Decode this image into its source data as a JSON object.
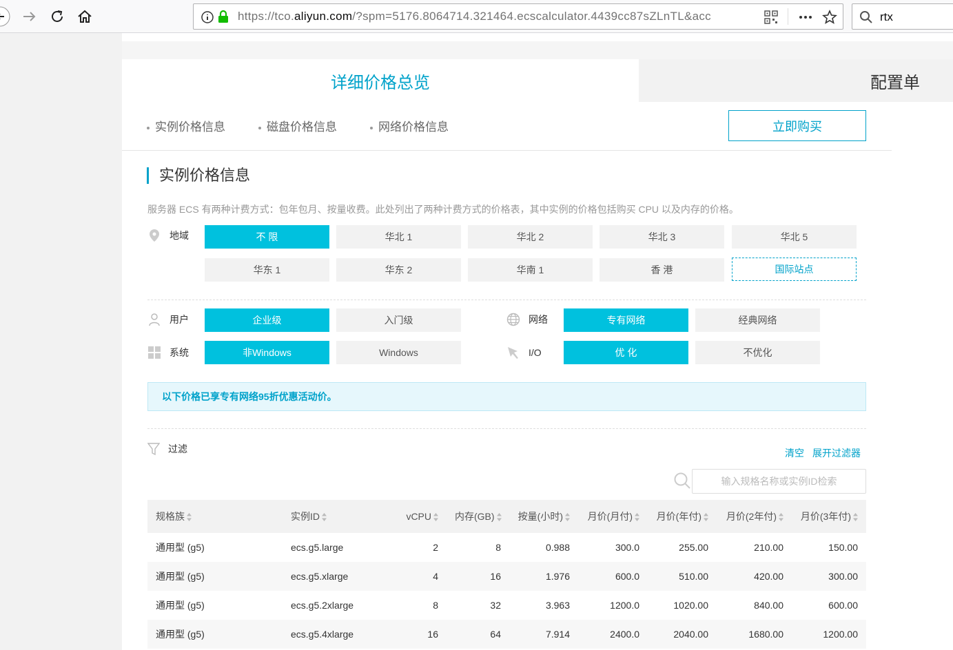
{
  "browser": {
    "url": "https://tco.aliyun.com/?spm=5176.8064714.321464.ecscalculator.4439cc87sZLnTL&acc",
    "url_host_prefix": "https://tco.",
    "url_host": "aliyun.com",
    "url_rest": "/?spm=5176.8064714.321464.ecscalculator.4439cc87sZLnTL&acc",
    "search_value": "rtx"
  },
  "tabs": {
    "detail": "详细价格总览",
    "config": "配置单"
  },
  "subnav": [
    "实例价格信息",
    "磁盘价格信息",
    "网络价格信息"
  ],
  "buy_label": "立即购买",
  "section": {
    "title": "实例价格信息",
    "desc": "服务器 ECS 有两种计费方式：包年包月、按量收费。此处列出了两种计费方式的价格表，其中实例的价格包括购买 CPU 以及内存的价格。"
  },
  "region": {
    "label": "地域",
    "row1": [
      "不 限",
      "华北 1",
      "华北 2",
      "华北 3",
      "华北 5"
    ],
    "row2": [
      "华东 1",
      "华东 2",
      "华南 1",
      "香 港",
      "国际站点"
    ]
  },
  "user": {
    "label": "用户",
    "options": [
      "企业级",
      "入门级"
    ]
  },
  "network": {
    "label": "网络",
    "options": [
      "专有网络",
      "经典网络"
    ]
  },
  "system": {
    "label": "系统",
    "options": [
      "非Windows",
      "Windows"
    ]
  },
  "io": {
    "label": "I/O",
    "options": [
      "优 化",
      "不优化"
    ]
  },
  "notice": "以下价格已享专有网络95折优惠活动价。",
  "filter": {
    "label": "过滤",
    "clear": "清空",
    "expand": "展开过滤器",
    "search_placeholder": "输入规格名称或实例ID检索"
  },
  "table": {
    "headers": [
      "规格族",
      "实例ID",
      "vCPU",
      "内存(GB)",
      "按量(小时)",
      "月价(月付)",
      "月价(年付)",
      "月价(2年付)",
      "月价(3年付)"
    ],
    "rows": [
      [
        "通用型 (g5)",
        "ecs.g5.large",
        "2",
        "8",
        "0.988",
        "300.0",
        "255.00",
        "210.00",
        "150.00"
      ],
      [
        "通用型 (g5)",
        "ecs.g5.xlarge",
        "4",
        "16",
        "1.976",
        "600.0",
        "510.00",
        "420.00",
        "300.00"
      ],
      [
        "通用型 (g5)",
        "ecs.g5.2xlarge",
        "8",
        "32",
        "3.963",
        "1200.0",
        "1020.00",
        "840.00",
        "600.00"
      ],
      [
        "通用型 (g5)",
        "ecs.g5.4xlarge",
        "16",
        "64",
        "7.914",
        "2400.0",
        "2040.00",
        "1680.00",
        "1200.00"
      ]
    ]
  },
  "colors": {
    "accent": "#00c1de",
    "link": "#00a2ca"
  }
}
